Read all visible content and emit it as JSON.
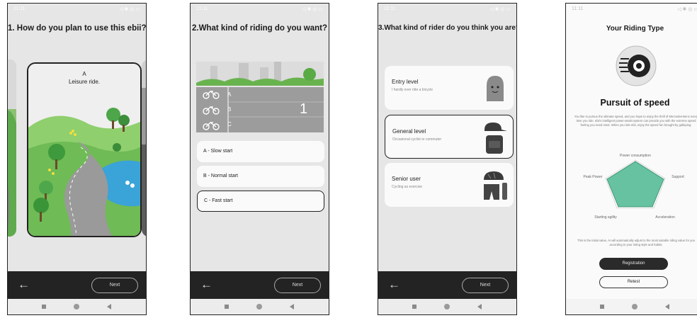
{
  "status": {
    "time": "11:11",
    "icons": "◁ ✱ ◎ ▭"
  },
  "screen1": {
    "title": "1. How do you plan to use this ebii?",
    "card_letter": "A",
    "card_caption": "Leisure ride.",
    "next_label": "Next",
    "back_icon": "arrow-left-icon"
  },
  "screen2": {
    "title": "2.What kind of riding do you want?",
    "lanes": [
      "A",
      "B",
      "C"
    ],
    "countdown": "1",
    "options": [
      "A - Slow start",
      "B - Normal start",
      "C - Fast start"
    ],
    "selected_option": 2,
    "next_label": "Next"
  },
  "screen3": {
    "title": "3.What kind of rider do you think you are?",
    "riders": [
      {
        "title": "Entry level",
        "subtitle": "I hardly ever ride a bicycle",
        "icon": "ghost-icon"
      },
      {
        "title": "General level",
        "subtitle": "Occasional cyclist or commuter",
        "icon": "cap-backpack-icon"
      },
      {
        "title": "Senior user",
        "subtitle": "Cycling as exercise",
        "icon": "helmet-shorts-bottle-icon"
      }
    ],
    "selected_rider": 1,
    "next_label": "Next"
  },
  "screen4": {
    "title": "Your Riding Type",
    "type_name": "Pursuit of speed",
    "description": "You like to pursue the ultimate speed, and you hope to enjoy the thrill of Mercedes-Benz every time you ride. ebii's intelligent power-assist system can provide you with the extreme speed feeling you need most. When you ride ebii, enjoy the speed fun brought by galloping.",
    "radar_axes": [
      "Power consumption",
      "Support",
      "Acceleration",
      "Starting agility",
      "Peak Power"
    ],
    "note": "This is the initial value, AI will automatically adjust to the most suitable riding value for you according to your riding style and habits.",
    "registration_label": "Registration",
    "retest_label": "Retest",
    "accent": "#66c2a0"
  }
}
